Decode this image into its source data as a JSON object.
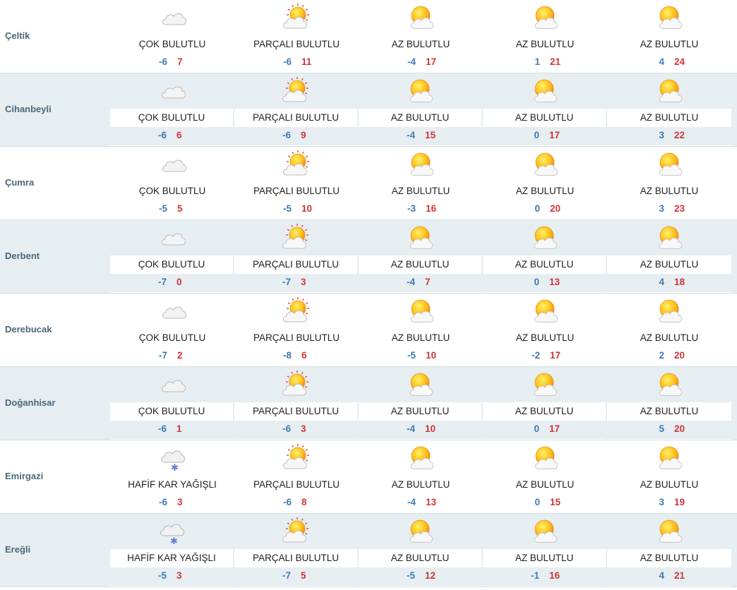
{
  "rows": [
    {
      "city": "Çeltik",
      "days": [
        {
          "icon": "cloudy-icon",
          "condition": "ÇOK BULUTLU",
          "min": "-6",
          "max": "7"
        },
        {
          "icon": "partly-cloudy-icon",
          "condition": "PARÇALI BULUTLU",
          "min": "-6",
          "max": "11"
        },
        {
          "icon": "mostly-sunny-icon",
          "condition": "AZ BULUTLU",
          "min": "-4",
          "max": "17"
        },
        {
          "icon": "mostly-sunny-icon",
          "condition": "AZ BULUTLU",
          "min": "1",
          "max": "21"
        },
        {
          "icon": "mostly-sunny-icon",
          "condition": "AZ BULUTLU",
          "min": "4",
          "max": "24"
        }
      ]
    },
    {
      "city": "Cihanbeyli",
      "days": [
        {
          "icon": "cloudy-icon",
          "condition": "ÇOK BULUTLU",
          "min": "-6",
          "max": "6"
        },
        {
          "icon": "partly-cloudy-icon",
          "condition": "PARÇALI BULUTLU",
          "min": "-6",
          "max": "9"
        },
        {
          "icon": "mostly-sunny-icon",
          "condition": "AZ BULUTLU",
          "min": "-4",
          "max": "15"
        },
        {
          "icon": "mostly-sunny-icon",
          "condition": "AZ BULUTLU",
          "min": "0",
          "max": "17"
        },
        {
          "icon": "mostly-sunny-icon",
          "condition": "AZ BULUTLU",
          "min": "3",
          "max": "22"
        }
      ]
    },
    {
      "city": "Çumra",
      "days": [
        {
          "icon": "cloudy-icon",
          "condition": "ÇOK BULUTLU",
          "min": "-5",
          "max": "5"
        },
        {
          "icon": "partly-cloudy-icon",
          "condition": "PARÇALI BULUTLU",
          "min": "-5",
          "max": "10"
        },
        {
          "icon": "mostly-sunny-icon",
          "condition": "AZ BULUTLU",
          "min": "-3",
          "max": "16"
        },
        {
          "icon": "mostly-sunny-icon",
          "condition": "AZ BULUTLU",
          "min": "0",
          "max": "20"
        },
        {
          "icon": "mostly-sunny-icon",
          "condition": "AZ BULUTLU",
          "min": "3",
          "max": "23"
        }
      ]
    },
    {
      "city": "Derbent",
      "days": [
        {
          "icon": "cloudy-icon",
          "condition": "ÇOK BULUTLU",
          "min": "-7",
          "max": "0"
        },
        {
          "icon": "partly-cloudy-icon",
          "condition": "PARÇALI BULUTLU",
          "min": "-7",
          "max": "3"
        },
        {
          "icon": "mostly-sunny-icon",
          "condition": "AZ BULUTLU",
          "min": "-4",
          "max": "7"
        },
        {
          "icon": "mostly-sunny-icon",
          "condition": "AZ BULUTLU",
          "min": "0",
          "max": "13"
        },
        {
          "icon": "mostly-sunny-icon",
          "condition": "AZ BULUTLU",
          "min": "4",
          "max": "18"
        }
      ]
    },
    {
      "city": "Derebucak",
      "days": [
        {
          "icon": "cloudy-icon",
          "condition": "ÇOK BULUTLU",
          "min": "-7",
          "max": "2"
        },
        {
          "icon": "partly-cloudy-icon",
          "condition": "PARÇALI BULUTLU",
          "min": "-8",
          "max": "6"
        },
        {
          "icon": "mostly-sunny-icon",
          "condition": "AZ BULUTLU",
          "min": "-5",
          "max": "10"
        },
        {
          "icon": "mostly-sunny-icon",
          "condition": "AZ BULUTLU",
          "min": "-2",
          "max": "17"
        },
        {
          "icon": "mostly-sunny-icon",
          "condition": "AZ BULUTLU",
          "min": "2",
          "max": "20"
        }
      ]
    },
    {
      "city": "Doğanhisar",
      "days": [
        {
          "icon": "cloudy-icon",
          "condition": "ÇOK BULUTLU",
          "min": "-6",
          "max": "1"
        },
        {
          "icon": "partly-cloudy-icon",
          "condition": "PARÇALI BULUTLU",
          "min": "-6",
          "max": "3"
        },
        {
          "icon": "mostly-sunny-icon",
          "condition": "AZ BULUTLU",
          "min": "-4",
          "max": "10"
        },
        {
          "icon": "mostly-sunny-icon",
          "condition": "AZ BULUTLU",
          "min": "0",
          "max": "17"
        },
        {
          "icon": "mostly-sunny-icon",
          "condition": "AZ BULUTLU",
          "min": "5",
          "max": "20"
        }
      ]
    },
    {
      "city": "Emirgazi",
      "days": [
        {
          "icon": "light-snow-icon",
          "condition": "HAFİF KAR YAĞIŞLI",
          "min": "-6",
          "max": "3"
        },
        {
          "icon": "partly-cloudy-icon",
          "condition": "PARÇALI BULUTLU",
          "min": "-6",
          "max": "8"
        },
        {
          "icon": "mostly-sunny-icon",
          "condition": "AZ BULUTLU",
          "min": "-4",
          "max": "13"
        },
        {
          "icon": "mostly-sunny-icon",
          "condition": "AZ BULUTLU",
          "min": "0",
          "max": "15"
        },
        {
          "icon": "mostly-sunny-icon",
          "condition": "AZ BULUTLU",
          "min": "3",
          "max": "19"
        }
      ]
    },
    {
      "city": "Ereğli",
      "days": [
        {
          "icon": "light-snow-icon",
          "condition": "HAFİF KAR YAĞIŞLI",
          "min": "-5",
          "max": "3"
        },
        {
          "icon": "partly-cloudy-icon",
          "condition": "PARÇALI BULUTLU",
          "min": "-7",
          "max": "5"
        },
        {
          "icon": "mostly-sunny-icon",
          "condition": "AZ BULUTLU",
          "min": "-5",
          "max": "12"
        },
        {
          "icon": "mostly-sunny-icon",
          "condition": "AZ BULUTLU",
          "min": "-1",
          "max": "16"
        },
        {
          "icon": "mostly-sunny-icon",
          "condition": "AZ BULUTLU",
          "min": "4",
          "max": "21"
        }
      ]
    }
  ],
  "colors": {
    "city": "#4a6878",
    "min_temp": "#3f79b5",
    "max_temp": "#d2343a",
    "alt_row": "#e6eef2",
    "sun": "#f5a623"
  }
}
